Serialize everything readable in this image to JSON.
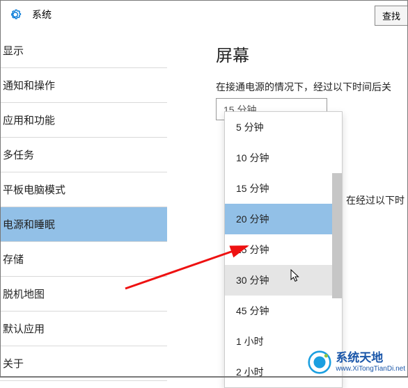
{
  "header": {
    "title": "系统",
    "search_label": "查找"
  },
  "sidebar": {
    "items": [
      {
        "label": "显示"
      },
      {
        "label": "通知和操作"
      },
      {
        "label": "应用和功能"
      },
      {
        "label": "多任务"
      },
      {
        "label": "平板电脑模式"
      },
      {
        "label": "电源和睡眠"
      },
      {
        "label": "存储"
      },
      {
        "label": "脱机地图"
      },
      {
        "label": "默认应用"
      },
      {
        "label": "关于"
      }
    ],
    "selected_index": 5
  },
  "content": {
    "section_title": "屏幕",
    "section_desc": "在接通电源的情况下，经过以下时间后关",
    "select_value": "15 分钟",
    "right_partial_text": "在经过以下时"
  },
  "dropdown": {
    "options": [
      {
        "label": "5 分钟"
      },
      {
        "label": "10 分钟"
      },
      {
        "label": "15 分钟"
      },
      {
        "label": "20 分钟"
      },
      {
        "label": "25 分钟"
      },
      {
        "label": "30 分钟"
      },
      {
        "label": "45 分钟"
      },
      {
        "label": "1 小时"
      },
      {
        "label": "2 小时"
      }
    ],
    "selected_index": 3,
    "hover_index": 5
  },
  "watermark": {
    "zh": "系统天地",
    "url": "www.XiTongTianDi.net"
  }
}
